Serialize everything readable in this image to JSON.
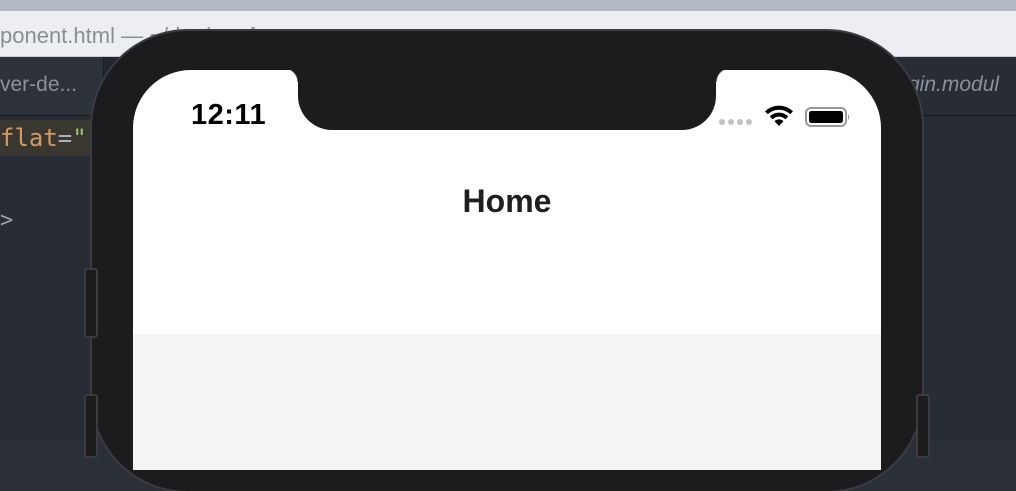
{
  "window": {
    "title": "ponent.html — ~/dev/wayfun"
  },
  "tabs": {
    "left_label": "ver-de...",
    "right_label": "gin.modul"
  },
  "editor": {
    "line1_attr": "flat",
    "line1_eq": "=",
    "line1_str": "\"",
    "line2": ">"
  },
  "phone": {
    "status": {
      "time": "12:11"
    },
    "nav": {
      "title": "Home"
    }
  },
  "icons": {
    "signal": "cellular-signal-icon",
    "wifi": "wifi-icon",
    "battery": "battery-icon"
  },
  "colors": {
    "phone_frame": "#1c1c1e",
    "screen_background": "#ffffff",
    "content_background": "#f4f4f4",
    "editor_background": "#282c34"
  }
}
